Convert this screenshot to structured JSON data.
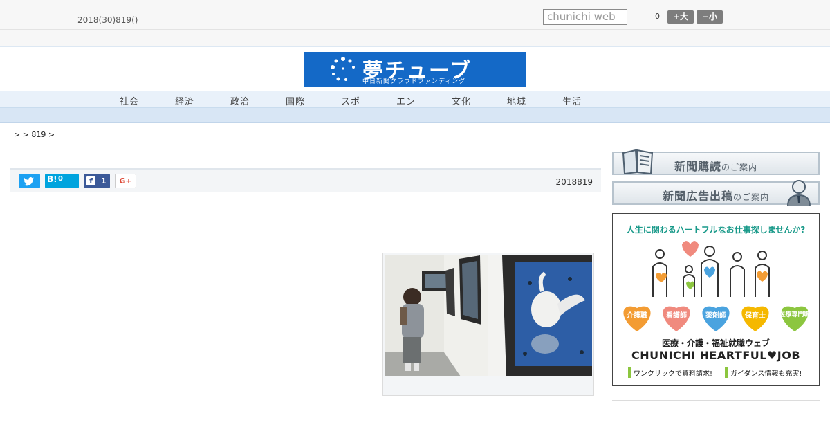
{
  "header": {
    "date": "2018(30)819()",
    "search_placeholder": "chunichi web",
    "font_size_label": "0",
    "font_bigger": "+大",
    "font_smaller": "−小"
  },
  "logo": {
    "title": "夢チューブ",
    "subtitle": "中日新聞クラウドファンディング"
  },
  "nav": {
    "items": [
      "社会",
      "経済",
      "政治",
      "国際",
      "スポ",
      "エン",
      "文化",
      "地域",
      "生活"
    ]
  },
  "breadcrumb": ">  > 819 >",
  "share": {
    "twitter_icon": "twitter-bird-icon",
    "hatena_label": "B!",
    "hatena_count": "0",
    "facebook_label": "f",
    "facebook_count": "1",
    "gplus_label": "G+"
  },
  "article": {
    "date": "2018819"
  },
  "sidebar": {
    "subscribe_main": "新聞購読",
    "subscribe_sub": "のご案内",
    "advertise_main": "新聞広告出稿",
    "advertise_sub": "のご案内",
    "ad": {
      "headline": "人生に関わるハートフルなお仕事探しませんか?",
      "hearts": [
        "介護職",
        "看護師",
        "薬剤師",
        "保育士",
        "医療専門職"
      ],
      "line1": "医療・介護・福祉就職ウェブ",
      "line2": "CHUNICHI HEARTFUL♥JOB",
      "line3": "ワンクリックで資料請求!",
      "line4": "ガイダンス情報も充実!",
      "heart_colors": [
        "#f39c33",
        "#f08a7e",
        "#4aa3df",
        "#f5b800",
        "#8cc63f"
      ]
    }
  }
}
